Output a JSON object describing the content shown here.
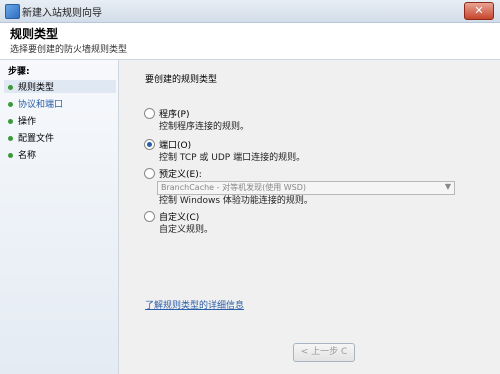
{
  "window": {
    "title": "新建入站规则向导"
  },
  "header": {
    "title": "规则类型",
    "description": "选择要创建的防火墙规则类型"
  },
  "sidebar": {
    "steps_label": "步骤:",
    "items": [
      {
        "label": "规则类型"
      },
      {
        "label": "协议和端口"
      },
      {
        "label": "操作"
      },
      {
        "label": "配置文件"
      },
      {
        "label": "名称"
      }
    ]
  },
  "main": {
    "prompt": "要创建的规则类型",
    "options": [
      {
        "label": "程序(P)",
        "description": "控制程序连接的规则。",
        "checked": false
      },
      {
        "label": "端口(O)",
        "description": "控制 TCP 或 UDP 端口连接的规则。",
        "checked": true
      },
      {
        "label": "预定义(E):",
        "description": "控制 Windows 体验功能连接的规则。",
        "checked": false
      },
      {
        "label": "自定义(C)",
        "description": "自定义规则。",
        "checked": false
      }
    ],
    "predefined_select": {
      "value": "BranchCache - 对等机发现(使用 WSD)"
    },
    "help_link": "了解规则类型的详细信息",
    "back_button": "< 上一步 C"
  }
}
